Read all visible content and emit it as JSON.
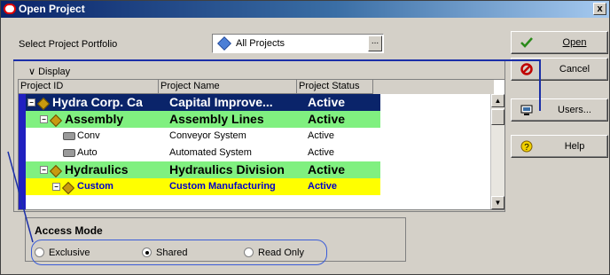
{
  "window": {
    "title": "Open Project",
    "close_label": "x"
  },
  "portfolio": {
    "label": "Select Project Portfolio",
    "value": "All Projects",
    "browse_label": "..."
  },
  "display": {
    "label": "∨ Display"
  },
  "table": {
    "columns": [
      "Project ID",
      "Project Name",
      "Project Status"
    ],
    "rows": [
      {
        "id": "Hydra Corp. Ca",
        "name": "Capital Improve...",
        "status": "Active",
        "level": 0,
        "bg": "#0a246a",
        "fg": "#ffffff",
        "bold": true,
        "large": true,
        "icon": "diamond",
        "expander": "−"
      },
      {
        "id": "Assembly",
        "name": "Assembly Lines",
        "status": "Active",
        "level": 1,
        "bg": "#80f080",
        "fg": "#000000",
        "bold": true,
        "large": true,
        "icon": "diamond",
        "expander": "−"
      },
      {
        "id": "Conv",
        "name": "Conveyor System",
        "status": "Active",
        "level": 2,
        "bg": "#ffffff",
        "fg": "#000000",
        "bold": false,
        "large": false,
        "icon": "project"
      },
      {
        "id": "Auto",
        "name": "Automated System",
        "status": "Active",
        "level": 2,
        "bg": "#ffffff",
        "fg": "#000000",
        "bold": false,
        "large": false,
        "icon": "project"
      },
      {
        "id": "Hydraulics",
        "name": "Hydraulics Division",
        "status": "Active",
        "level": 1,
        "bg": "#80f080",
        "fg": "#000000",
        "bold": true,
        "large": true,
        "icon": "diamond",
        "expander": "−"
      },
      {
        "id": "Custom",
        "name": "Custom Manufacturing",
        "status": "Active",
        "level": 2,
        "bg": "#ffff00",
        "fg": "#0000cc",
        "bold": true,
        "large": false,
        "icon": "diamond",
        "expander": "−"
      }
    ]
  },
  "access_mode": {
    "title": "Access Mode",
    "options": [
      {
        "label": "Exclusive",
        "selected": false
      },
      {
        "label": "Shared",
        "selected": true
      },
      {
        "label": "Read Only",
        "selected": false
      }
    ]
  },
  "buttons": {
    "open": "Open",
    "cancel": "Cancel",
    "users": "Users...",
    "help": "Help"
  },
  "colors": {
    "callout": "#1b2fa8",
    "accent": "#0a246a"
  }
}
